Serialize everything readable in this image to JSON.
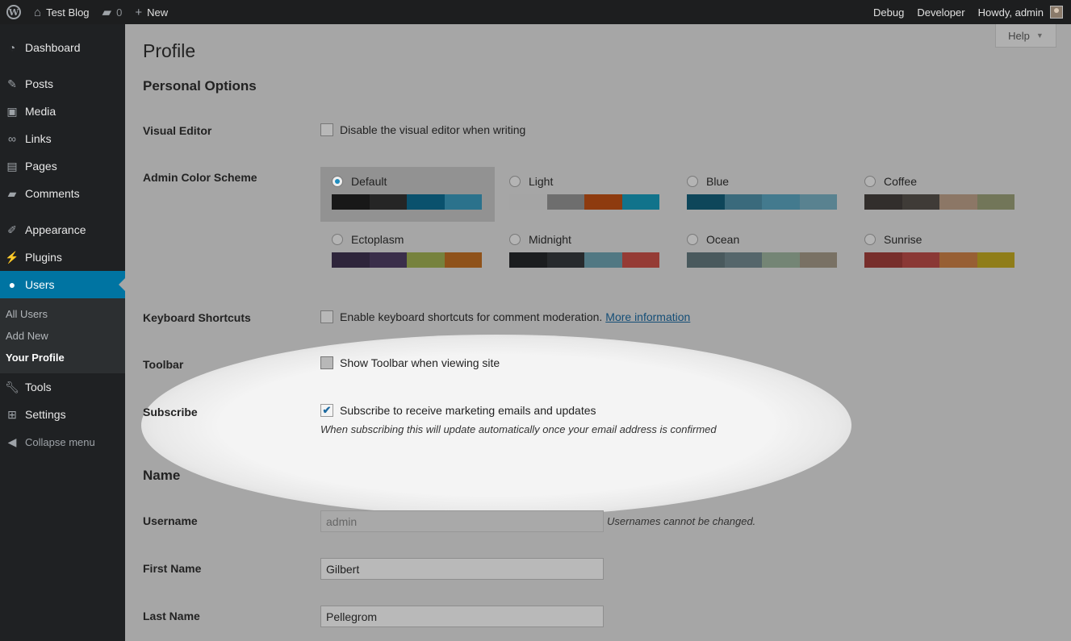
{
  "adminbar": {
    "site_name": "Test Blog",
    "comments_count": "0",
    "new_label": "New",
    "debug_label": "Debug",
    "developer_label": "Developer",
    "howdy_label": "Howdy, admin"
  },
  "sidebar": {
    "items": [
      {
        "label": "Dashboard",
        "icon": "dashboard-icon"
      },
      {
        "label": "Posts",
        "icon": "pin-icon"
      },
      {
        "label": "Media",
        "icon": "media-icon"
      },
      {
        "label": "Links",
        "icon": "link-icon"
      },
      {
        "label": "Pages",
        "icon": "pages-icon"
      },
      {
        "label": "Comments",
        "icon": "comment-icon"
      },
      {
        "label": "Appearance",
        "icon": "brush-icon"
      },
      {
        "label": "Plugins",
        "icon": "plug-icon"
      },
      {
        "label": "Users",
        "icon": "user-icon"
      },
      {
        "label": "Tools",
        "icon": "wrench-icon"
      },
      {
        "label": "Settings",
        "icon": "settings-icon"
      }
    ],
    "submenu": [
      "All Users",
      "Add New",
      "Your Profile"
    ],
    "collapse_label": "Collapse menu"
  },
  "help_label": "Help",
  "page_title": "Profile",
  "personal_options": {
    "title": "Personal Options",
    "visual_editor": {
      "label": "Visual Editor",
      "text": "Disable the visual editor when writing",
      "checked": false
    },
    "admin_color_scheme": {
      "label": "Admin Color Scheme",
      "schemes": [
        {
          "name": "Default",
          "selected": true,
          "colors": [
            "#222222",
            "#333333",
            "#0074a2",
            "#2ea2cc"
          ]
        },
        {
          "name": "Light",
          "selected": false,
          "colors": [
            "#e5e5e5",
            "#999999",
            "#d64e07",
            "#04a4cc"
          ]
        },
        {
          "name": "Blue",
          "selected": false,
          "colors": [
            "#096484",
            "#4796b3",
            "#52accc",
            "#74B6CE"
          ]
        },
        {
          "name": "Coffee",
          "selected": false,
          "colors": [
            "#46403c",
            "#59524c",
            "#c7a589",
            "#9ea476"
          ]
        },
        {
          "name": "Ectoplasm",
          "selected": false,
          "colors": [
            "#413256",
            "#523f6d",
            "#a3b745",
            "#d46f15"
          ]
        },
        {
          "name": "Midnight",
          "selected": false,
          "colors": [
            "#25282b",
            "#363b3f",
            "#69a8bb",
            "#e14d43"
          ]
        },
        {
          "name": "Ocean",
          "selected": false,
          "colors": [
            "#627c83",
            "#738e96",
            "#9ebaa0",
            "#aa9d88"
          ]
        },
        {
          "name": "Sunrise",
          "selected": false,
          "colors": [
            "#b43c38",
            "#cf4944",
            "#dd823b",
            "#ccaf0b"
          ]
        }
      ]
    },
    "keyboard_shortcuts": {
      "label": "Keyboard Shortcuts",
      "text": "Enable keyboard shortcuts for comment moderation.",
      "link": "More information",
      "checked": false
    },
    "toolbar": {
      "label": "Toolbar",
      "text": "Show Toolbar when viewing site",
      "checked": false
    },
    "subscribe": {
      "label": "Subscribe",
      "text": "Subscribe to receive marketing emails and updates",
      "checked": true,
      "description": "When subscribing this will update automatically once your email address is confirmed"
    }
  },
  "name_section": {
    "title": "Name",
    "username": {
      "label": "Username",
      "value": "admin",
      "hint": "Usernames cannot be changed."
    },
    "first_name": {
      "label": "First Name",
      "value": "Gilbert"
    },
    "last_name": {
      "label": "Last Name",
      "value": "Pellegrom"
    }
  },
  "colors": {
    "accent": "#0074a2",
    "sidebar_bg": "#1f2123",
    "adminbar_bg": "#1d1e1f"
  }
}
